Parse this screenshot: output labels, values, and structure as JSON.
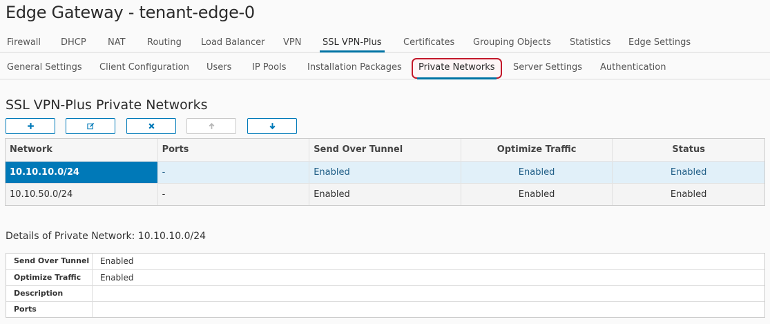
{
  "page": {
    "title": "Edge Gateway - tenant-edge-0"
  },
  "main_tabs": [
    {
      "label": "Firewall"
    },
    {
      "label": "DHCP"
    },
    {
      "label": "NAT"
    },
    {
      "label": "Routing"
    },
    {
      "label": "Load Balancer"
    },
    {
      "label": "VPN"
    },
    {
      "label": "SSL VPN-Plus"
    },
    {
      "label": "Certificates"
    },
    {
      "label": "Grouping Objects"
    },
    {
      "label": "Statistics"
    },
    {
      "label": "Edge Settings"
    }
  ],
  "main_tabs_active": "SSL VPN-Plus",
  "sub_tabs": [
    {
      "label": "General Settings"
    },
    {
      "label": "Client Configuration"
    },
    {
      "label": "Users"
    },
    {
      "label": "IP Pools"
    },
    {
      "label": "Installation Packages"
    },
    {
      "label": "Private Networks"
    },
    {
      "label": "Server Settings"
    },
    {
      "label": "Authentication"
    }
  ],
  "sub_tabs_active": "Private Networks",
  "section": {
    "title": "SSL VPN-Plus Private Networks"
  },
  "toolbar": {
    "add_icon": "plus-icon",
    "edit_icon": "edit-icon",
    "delete_icon": "x-icon",
    "move_up_icon": "arrow-up-icon",
    "move_down_icon": "arrow-down-icon"
  },
  "grid": {
    "columns": [
      "Network",
      "Ports",
      "Send Over Tunnel",
      "Optimize Traffic",
      "Status"
    ],
    "rows": [
      {
        "network": "10.10.10.0/24",
        "ports": "-",
        "send_over_tunnel": "Enabled",
        "optimize_traffic": "Enabled",
        "status": "Enabled",
        "selected": true
      },
      {
        "network": "10.10.50.0/24",
        "ports": "-",
        "send_over_tunnel": "Enabled",
        "optimize_traffic": "Enabled",
        "status": "Enabled",
        "selected": false
      }
    ]
  },
  "details": {
    "title": "Details of Private Network: 10.10.10.0/24",
    "fields": [
      {
        "key": "Send Over Tunnel",
        "value": "Enabled"
      },
      {
        "key": "Optimize Traffic",
        "value": "Enabled"
      },
      {
        "key": "Description",
        "value": ""
      },
      {
        "key": "Ports",
        "value": ""
      }
    ]
  },
  "colors": {
    "accent": "#0079b8",
    "highlight_border": "#c2192a",
    "selected_row": "#e1f0f9"
  }
}
